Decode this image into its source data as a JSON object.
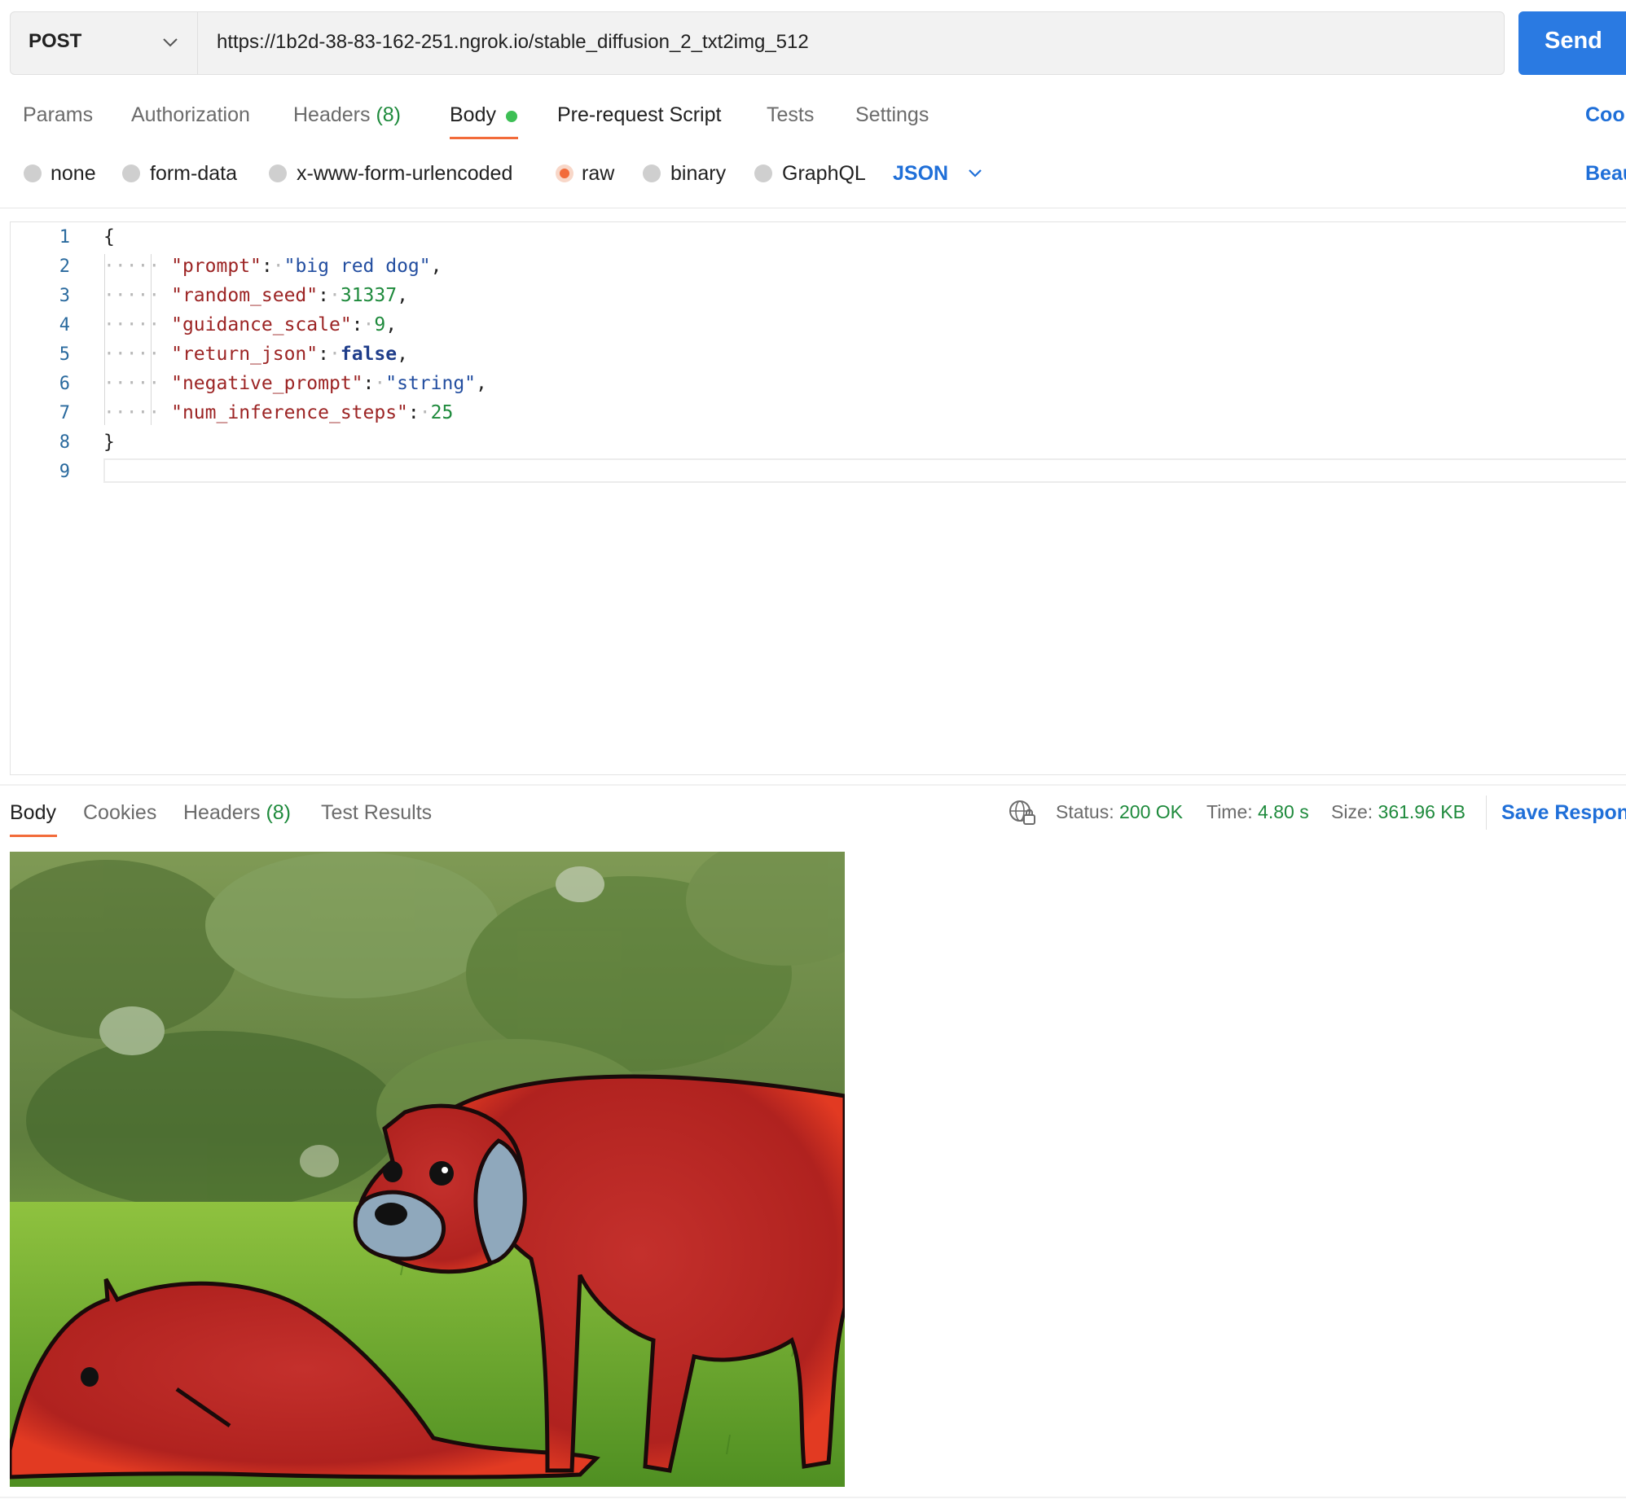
{
  "request": {
    "method": "POST",
    "url": "https://1b2d-38-83-162-251.ngrok.io/stable_diffusion_2_txt2img_512",
    "send_label": "Send"
  },
  "request_tabs": {
    "params": "Params",
    "authorization": "Authorization",
    "headers": "Headers",
    "headers_count": "(8)",
    "body": "Body",
    "pre_request": "Pre-request Script",
    "tests": "Tests",
    "settings": "Settings",
    "cookies": "Cookies"
  },
  "body_types": {
    "none": "none",
    "form_data": "form-data",
    "urlencoded": "x-www-form-urlencoded",
    "raw": "raw",
    "binary": "binary",
    "graphql": "GraphQL",
    "selected": "raw",
    "format": "JSON",
    "beautify": "Beautify"
  },
  "editor": {
    "line_numbers": [
      "1",
      "2",
      "3",
      "4",
      "5",
      "6",
      "7",
      "8",
      "9"
    ],
    "open_brace": "{",
    "close_brace": "}",
    "fields": [
      {
        "key": "\"prompt\"",
        "value": "\"big red dog\"",
        "kind": "string",
        "comma": ","
      },
      {
        "key": "\"random_seed\"",
        "value": "31337",
        "kind": "number",
        "comma": ","
      },
      {
        "key": "\"guidance_scale\"",
        "value": "9",
        "kind": "number",
        "comma": ","
      },
      {
        "key": "\"return_json\"",
        "value": "false",
        "kind": "boolean",
        "comma": ","
      },
      {
        "key": "\"negative_prompt\"",
        "value": "\"string\"",
        "kind": "string",
        "comma": ","
      },
      {
        "key": "\"num_inference_steps\"",
        "value": "25",
        "kind": "number",
        "comma": ""
      }
    ]
  },
  "response": {
    "tabs": {
      "body": "Body",
      "cookies": "Cookies",
      "headers": "Headers",
      "headers_count": "(8)",
      "test_results": "Test Results"
    },
    "status_label": "Status:",
    "status_value": "200 OK",
    "time_label": "Time:",
    "time_value": "4.80 s",
    "size_label": "Size:",
    "size_value": "361.96 KB",
    "save_label": "Save Response"
  },
  "colors": {
    "accent_blue": "#2a7ae2",
    "active_tab_orange": "#f26b3a",
    "success_green": "#1e8a3c",
    "json_key": "#9c2424",
    "json_string": "#234ea0"
  },
  "icons": {
    "method_dropdown": "chevron-down-icon",
    "format_dropdown": "chevron-down-icon",
    "network": "globe-lock-icon",
    "body_modified": "status-dot-icon"
  }
}
